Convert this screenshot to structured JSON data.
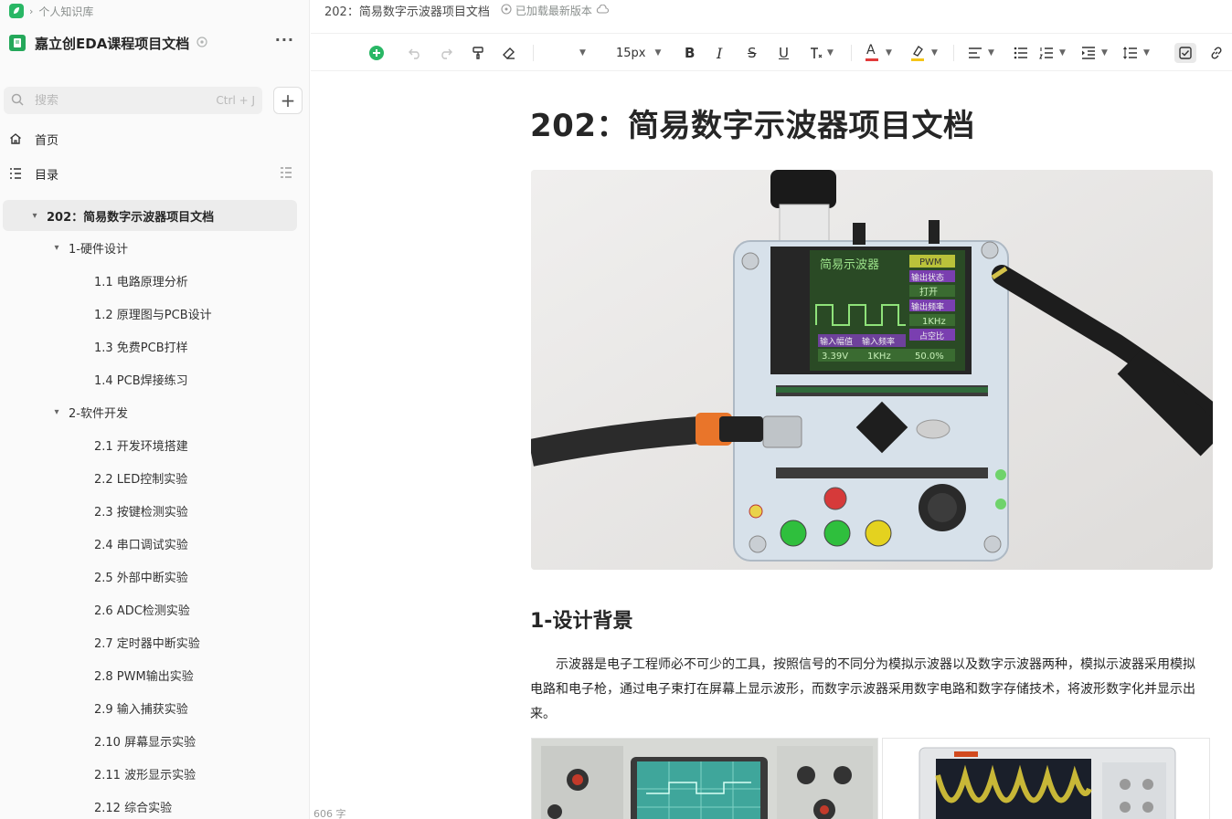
{
  "breadcrumb": {
    "label": "个人知识库"
  },
  "book": {
    "title": "嘉立创EDA课程项目文档",
    "more": "···"
  },
  "search": {
    "placeholder": "搜索",
    "shortcut": "Ctrl + J"
  },
  "nav": {
    "home": "首页",
    "toc": "目录"
  },
  "tree": [
    {
      "label": "202：简易数字示波器项目文档",
      "level": 0,
      "expanded": true,
      "active": true
    },
    {
      "label": "1-硬件设计",
      "level": 1,
      "expanded": true
    },
    {
      "label": "1.1 电路原理分析",
      "level": 2
    },
    {
      "label": "1.2 原理图与PCB设计",
      "level": 2
    },
    {
      "label": "1.3 免费PCB打样",
      "level": 2
    },
    {
      "label": "1.4 PCB焊接练习",
      "level": 2
    },
    {
      "label": "2-软件开发",
      "level": 1,
      "expanded": true
    },
    {
      "label": "2.1 开发环境搭建",
      "level": 2
    },
    {
      "label": "2.2 LED控制实验",
      "level": 2
    },
    {
      "label": "2.3 按键检测实验",
      "level": 2
    },
    {
      "label": "2.4 串口调试实验",
      "level": 2
    },
    {
      "label": "2.5 外部中断实验",
      "level": 2
    },
    {
      "label": "2.6 ADC检测实验",
      "level": 2
    },
    {
      "label": "2.7 定时器中断实验",
      "level": 2
    },
    {
      "label": "2.8 PWM输出实验",
      "level": 2
    },
    {
      "label": "2.9 输入捕获实验",
      "level": 2
    },
    {
      "label": "2.10 屏幕显示实验",
      "level": 2
    },
    {
      "label": "2.11 波形显示实验",
      "level": 2
    },
    {
      "label": "2.12 综合实验",
      "level": 2
    }
  ],
  "doc": {
    "tab_title": "202：简易数字示波器项目文档",
    "status": "已加载最新版本",
    "title": "202：简易数字示波器项目文档",
    "section1": "1-设计背景",
    "para1": "示波器是电子工程师必不可少的工具，按照信号的不同分为模拟示波器以及数字示波器两种，模拟示波器采用模拟电路和电子枪，通过电子束打在屏幕上显示波形，而数字示波器采用数字电路和数字存储技术，将波形数字化并显示出来。",
    "word_count": "606 字"
  },
  "toolbar": {
    "font_size": "15px"
  },
  "lcd": {
    "title": "简易示波器",
    "pwm": "PWM",
    "out_state": "输出状态",
    "open": "打开",
    "out_freq": "输出频率",
    "freq": "1KHz",
    "duty": "占空比",
    "in_amp": "输入幅值",
    "in_freq": "输入频率",
    "amp_val": "3.39V",
    "freq_val": "1KHz",
    "duty_val": "50.0%"
  },
  "colors": {
    "accent": "#29b765",
    "active_bg": "#ececec"
  }
}
